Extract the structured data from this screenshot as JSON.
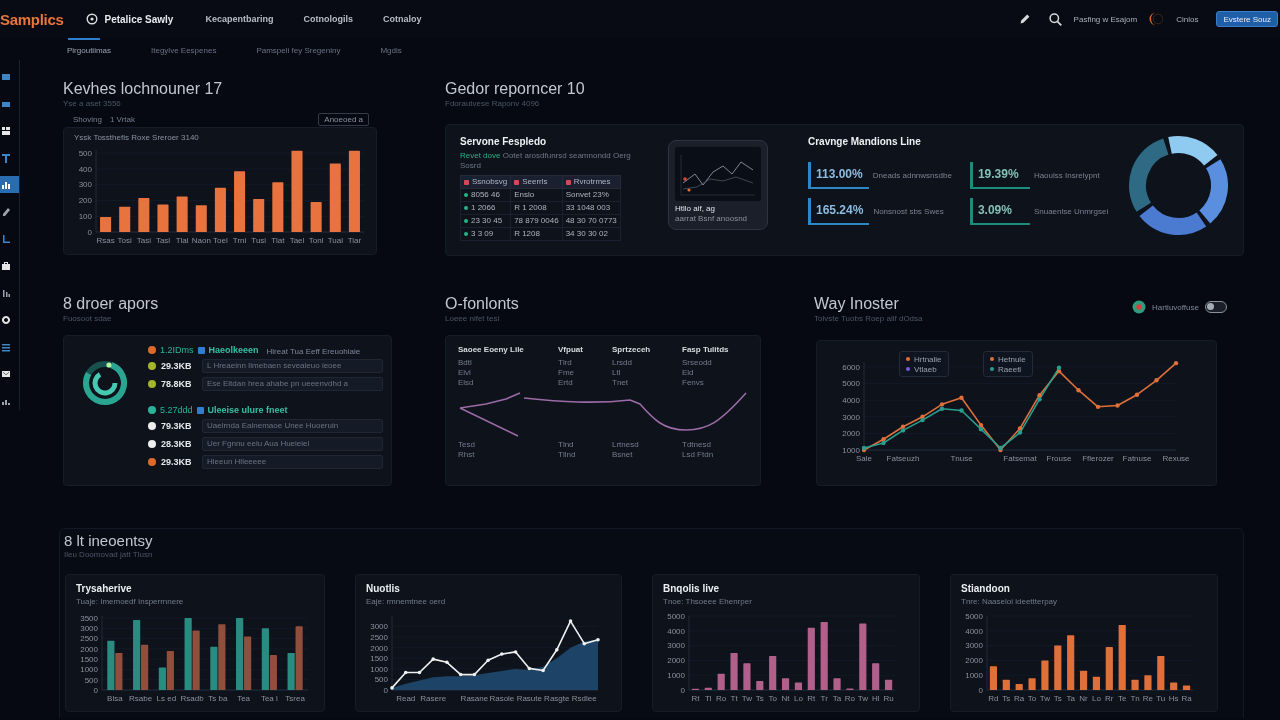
{
  "header": {
    "logo": "Samplics",
    "workspace": "Petalice Sawly",
    "nav": [
      {
        "label": "Kecapentbaring",
        "selected": false
      },
      {
        "label": "Cotnologils",
        "selected": false
      },
      {
        "label": "Cotnaloy",
        "selected": false
      }
    ],
    "user_label": "Pasfing w Esajom",
    "user_name": "Cinlos",
    "action_button": "Evstere Souz"
  },
  "tabs": [
    {
      "label": "Pirgoutiimas",
      "selected": true
    },
    {
      "label": "Itegylve Eespenes",
      "selected": false
    },
    {
      "label": "Pamspeli fey Sregeniny",
      "selected": false
    },
    {
      "label": "Mgdis",
      "selected": false
    }
  ],
  "sidebar": {
    "items": [
      {
        "selected": false
      },
      {
        "selected": false
      },
      {
        "selected": false
      },
      {
        "selected": false
      },
      {
        "selected": true
      },
      {
        "selected": false
      },
      {
        "selected": false
      },
      {
        "selected": false
      },
      {
        "selected": false
      },
      {
        "selected": false
      },
      {
        "selected": false
      },
      {
        "selected": false
      },
      {
        "selected": false
      }
    ]
  },
  "sales": {
    "title": "Kevhes lochnouner 17",
    "subtitle": "Yse a aset 3556",
    "filter_label": "Shoving",
    "filter_value": "1 Vrtak",
    "range_select": "Anoeoed a",
    "caption": "Yssk Tossthefis Roxe Sreroer 3140",
    "chart_data": {
      "type": "bar",
      "categories": [
        "Rsas",
        "Tosi",
        "Tasi",
        "Tasl",
        "Tlal",
        "Naon",
        "Toel",
        "Trni",
        "Tusi",
        "Tlat",
        "Tael",
        "Tonl",
        "Tual",
        "Tiar"
      ],
      "series": [
        {
          "color": "#e8733f",
          "values": [
            95,
            160,
            215,
            175,
            225,
            170,
            280,
            385,
            210,
            315,
            515,
            190,
            435,
            515
          ]
        }
      ],
      "ylim": [
        0,
        520
      ],
      "yticks": [
        0,
        100,
        200,
        300,
        400,
        500
      ],
      "grid": true
    }
  },
  "report": {
    "title": "Gedor reporncer 10",
    "subtitle": "Fdorautvese Raponv 4096",
    "summary": {
      "title": "Servone Fespledo",
      "status": "Revet dove",
      "note": "Ootet arosdfunrsd seamnondd Oerg Sosrd",
      "table": {
        "columns": [
          "Ssnobsvg",
          "Seerrls",
          "Rvrotrmes"
        ],
        "rows": [
          [
            "8056 46",
            "Enslo",
            "Sonvet 23%"
          ],
          [
            "1 2066",
            "R 1 2008",
            "33 1048 003"
          ],
          [
            "23 30 45",
            "78 879 0046",
            "48 30 70 0773"
          ],
          [
            "3 3 09",
            "R 1208",
            "34 30 30 02"
          ]
        ]
      }
    },
    "preview": {
      "caption": "Htllo aif, ag",
      "detail": "aarrat Bsnf anoosnd"
    },
    "metrics": {
      "title": "Cravnge Mandions Line",
      "items": [
        {
          "value": "113.00%",
          "label": "Dneads adnnwsnsdbe",
          "color": "#2f86c6"
        },
        {
          "value": "19.39%",
          "label": "Haoulss Insrelypnt",
          "color": "#1e8c7c"
        },
        {
          "value": "165.24%",
          "label": "Nonsnost sbs Swes",
          "color": "#2f86c6"
        },
        {
          "value": "3.09%",
          "label": "Snuaenlse Unmrgsei",
          "color": "#1e8c7c"
        }
      ]
    }
  },
  "activity": {
    "title": "8 droer apors",
    "subtitle": "Fuosoot sdae",
    "groups": [
      {
        "value": "1.2IDms",
        "label": "Haeolkeeen",
        "note": "Hlreat Tua Eeff Ereuohiaie",
        "color": "#e06a2c",
        "rows": [
          {
            "value": "29.3KB",
            "text": "L Hreaeinn Ilmebaen sevealeuo ieoee",
            "color": "#a3b52a"
          },
          {
            "value": "78.8KB",
            "text": "Ese Eltdan hrea ahabe pn ueeenvdhd a",
            "color": "#a3b52a"
          }
        ]
      },
      {
        "value": "5.27ddd",
        "label": "Uleeise ulure fneet",
        "color": "#2bb39a",
        "rows": [
          {
            "value": "79.3KB",
            "text": "Uaelrnda Ealnemaoe Unee Huoeruin",
            "color": "#eeeeee"
          },
          {
            "value": "28.3KB",
            "text": "Uer Fgnnu eelu Aua Hueieiel",
            "color": "#eeeeee"
          },
          {
            "value": "29.3KB",
            "text": "Hleeun Hlleeeee",
            "color": "#e06a2c"
          }
        ]
      }
    ]
  },
  "events": {
    "title": "O-fonlonts",
    "subtitle": "Loeee nifet tesi",
    "columns": [
      "Saoee Eoeny Lile",
      "Vfpuat",
      "Sprtzeceh",
      "Fasp Tulitds"
    ],
    "top_rows": [
      [
        "Bdtl",
        "Tlrd",
        "Lrsdd",
        "Srseodd"
      ],
      [
        "Elvl",
        "Fme",
        "Ltl",
        "Eld"
      ],
      [
        "Elsd",
        "Ertd",
        "Tnet",
        "Fenvs"
      ]
    ],
    "bottom_rows": [
      [
        "Tesd",
        "Tlnd",
        "Lrtnesd",
        "Tdtnesd"
      ],
      [
        "Rhst",
        "Tllnd",
        "Bsnet",
        "Lsd Ftdn"
      ]
    ]
  },
  "trend": {
    "title": "Way Inoster",
    "subtitle": "Tolvste Tuobs Roep alif dOdsa",
    "toggle": {
      "label": "Hartiuvoffuse",
      "on": false
    },
    "legends": [
      {
        "entries": [
          {
            "label": "Hrtnalie",
            "color": "#e0703a"
          },
          {
            "label": "Vtlaeb",
            "color": "#7a5ad8"
          }
        ]
      },
      {
        "entries": [
          {
            "label": "Hetnuie",
            "color": "#e0703a"
          },
          {
            "label": "Raeetl",
            "color": "#2a9d8f"
          }
        ]
      }
    ],
    "chart_data": {
      "type": "line",
      "categories": [
        "Sale",
        null,
        "Fatseuzh",
        null,
        null,
        "Tnuse",
        null,
        null,
        "Fatsemat",
        null,
        "Frouse",
        null,
        "Fflerozer",
        null,
        "Fatnuse",
        null,
        "Rexuse"
      ],
      "series": [
        {
          "color": "#e0703a",
          "values": [
            1000,
            1650,
            2400,
            3000,
            3750,
            4150,
            2500,
            1000,
            2300,
            4300,
            5750,
            4600,
            3600,
            3680,
            4330,
            5200,
            6230
          ]
        },
        {
          "color": "#2a9d8f",
          "values": [
            1120,
            1420,
            2180,
            2800,
            3480,
            3380,
            2250,
            1120,
            2050,
            4050,
            5950,
            null,
            null,
            null,
            null,
            null,
            null
          ]
        }
      ],
      "ylim": [
        1000,
        6300
      ],
      "yticks": [
        1000,
        2000,
        3000,
        4000,
        5000,
        6000
      ],
      "grid": true
    }
  },
  "inventory": {
    "title": "8 lt ineoentsy",
    "subtitle": "Ileu Doomovad jatt Tlusn",
    "cards": [
      {
        "title": "Trysaherive",
        "subtitle": "Tuaje: Imemoedf Insperrnnere",
        "chart_data": {
          "type": "bar",
          "categories": [
            "Blsa",
            "Rsabe",
            "Ls ed",
            "Rsadb",
            "Ts ba",
            "Tea",
            "Tea l",
            "Tsrea"
          ],
          "series": [
            {
              "color": "#2a8c80",
              "values": [
                2400,
                3400,
                1100,
                3500,
                2100,
                3500,
                3000,
                1800
              ]
            },
            {
              "color": "#8f4f3c",
              "values": [
                1800,
                2200,
                1900,
                2900,
                3200,
                2600,
                1700,
                3100
              ]
            }
          ],
          "ylim": [
            0,
            3600
          ],
          "yticks": [
            0,
            500,
            1000,
            1500,
            2000,
            2500,
            3000,
            3500
          ],
          "grid": true
        }
      },
      {
        "title": "Nuotlis",
        "subtitle": "Eaje: rmnemtnee oerd",
        "chart_data": {
          "type": "area",
          "categories": [
            null,
            "Read",
            null,
            "Rasere",
            null,
            null,
            "Rasane",
            null,
            "Rasole",
            null,
            "Rasute",
            null,
            "Rasgte",
            null,
            "Rsdlee",
            null
          ],
          "series": [
            {
              "color": "#1d4466",
              "values": [
                100,
                300,
                450,
                600,
                650,
                650,
                700,
                800,
                900,
                1000,
                950,
                1100,
                1500,
                2000,
                2300,
                2400
              ]
            },
            {
              "color": "#f0f0f0",
              "type": "line",
              "values": [
                100,
                830,
                830,
                1460,
                1310,
                730,
                730,
                1410,
                1700,
                1800,
                1020,
                920,
                1900,
                3260,
                2190,
                2380
              ]
            }
          ],
          "ylim": [
            0,
            3500
          ],
          "yticks": [
            0,
            500,
            1000,
            1500,
            2000,
            2500,
            3000
          ],
          "grid": true
        }
      },
      {
        "title": "Bnqolis live",
        "subtitle": "Tnoe: Thsoeee Ehenrper",
        "chart_data": {
          "type": "bar",
          "categories": [
            "Rt",
            "Tl",
            "Ro",
            "Tt",
            "Tw",
            "Ts",
            "To",
            "Nt",
            "Lo",
            "Rt",
            "Tr",
            "Ta",
            "Ro",
            "Tw",
            "Hl",
            "Ru"
          ],
          "series": [
            {
              "color": "#b0608a",
              "values": [
                80,
                150,
                1100,
                2500,
                1800,
                600,
                2300,
                800,
                500,
                4200,
                4600,
                800,
                100,
                4500,
                1800,
                700
              ]
            }
          ],
          "ylim": [
            0,
            5000
          ],
          "yticks": [
            0,
            1000,
            2000,
            3000,
            4000,
            5000
          ],
          "grid": true
        }
      },
      {
        "title": "Stiandoon",
        "subtitle": "Tnre: Naaseloi ideettterpay",
        "chart_data": {
          "type": "bar",
          "categories": [
            "Rd",
            "Ts",
            "Ra",
            "To",
            "Tw",
            "Ts",
            "Ta",
            "Nr",
            "Lo",
            "Rr",
            "Te",
            "Tn",
            "Re",
            "Tu",
            "Hs",
            "Ra"
          ],
          "series": [
            {
              "color": "#e0703a",
              "values": [
                1600,
                700,
                400,
                800,
                2000,
                3000,
                3700,
                1300,
                900,
                2900,
                4400,
                700,
                1000,
                2300,
                500,
                300
              ]
            }
          ],
          "ylim": [
            0,
            5000
          ],
          "yticks": [
            0,
            1000,
            2000,
            3000,
            4000,
            5000
          ],
          "grid": true
        }
      }
    ]
  }
}
